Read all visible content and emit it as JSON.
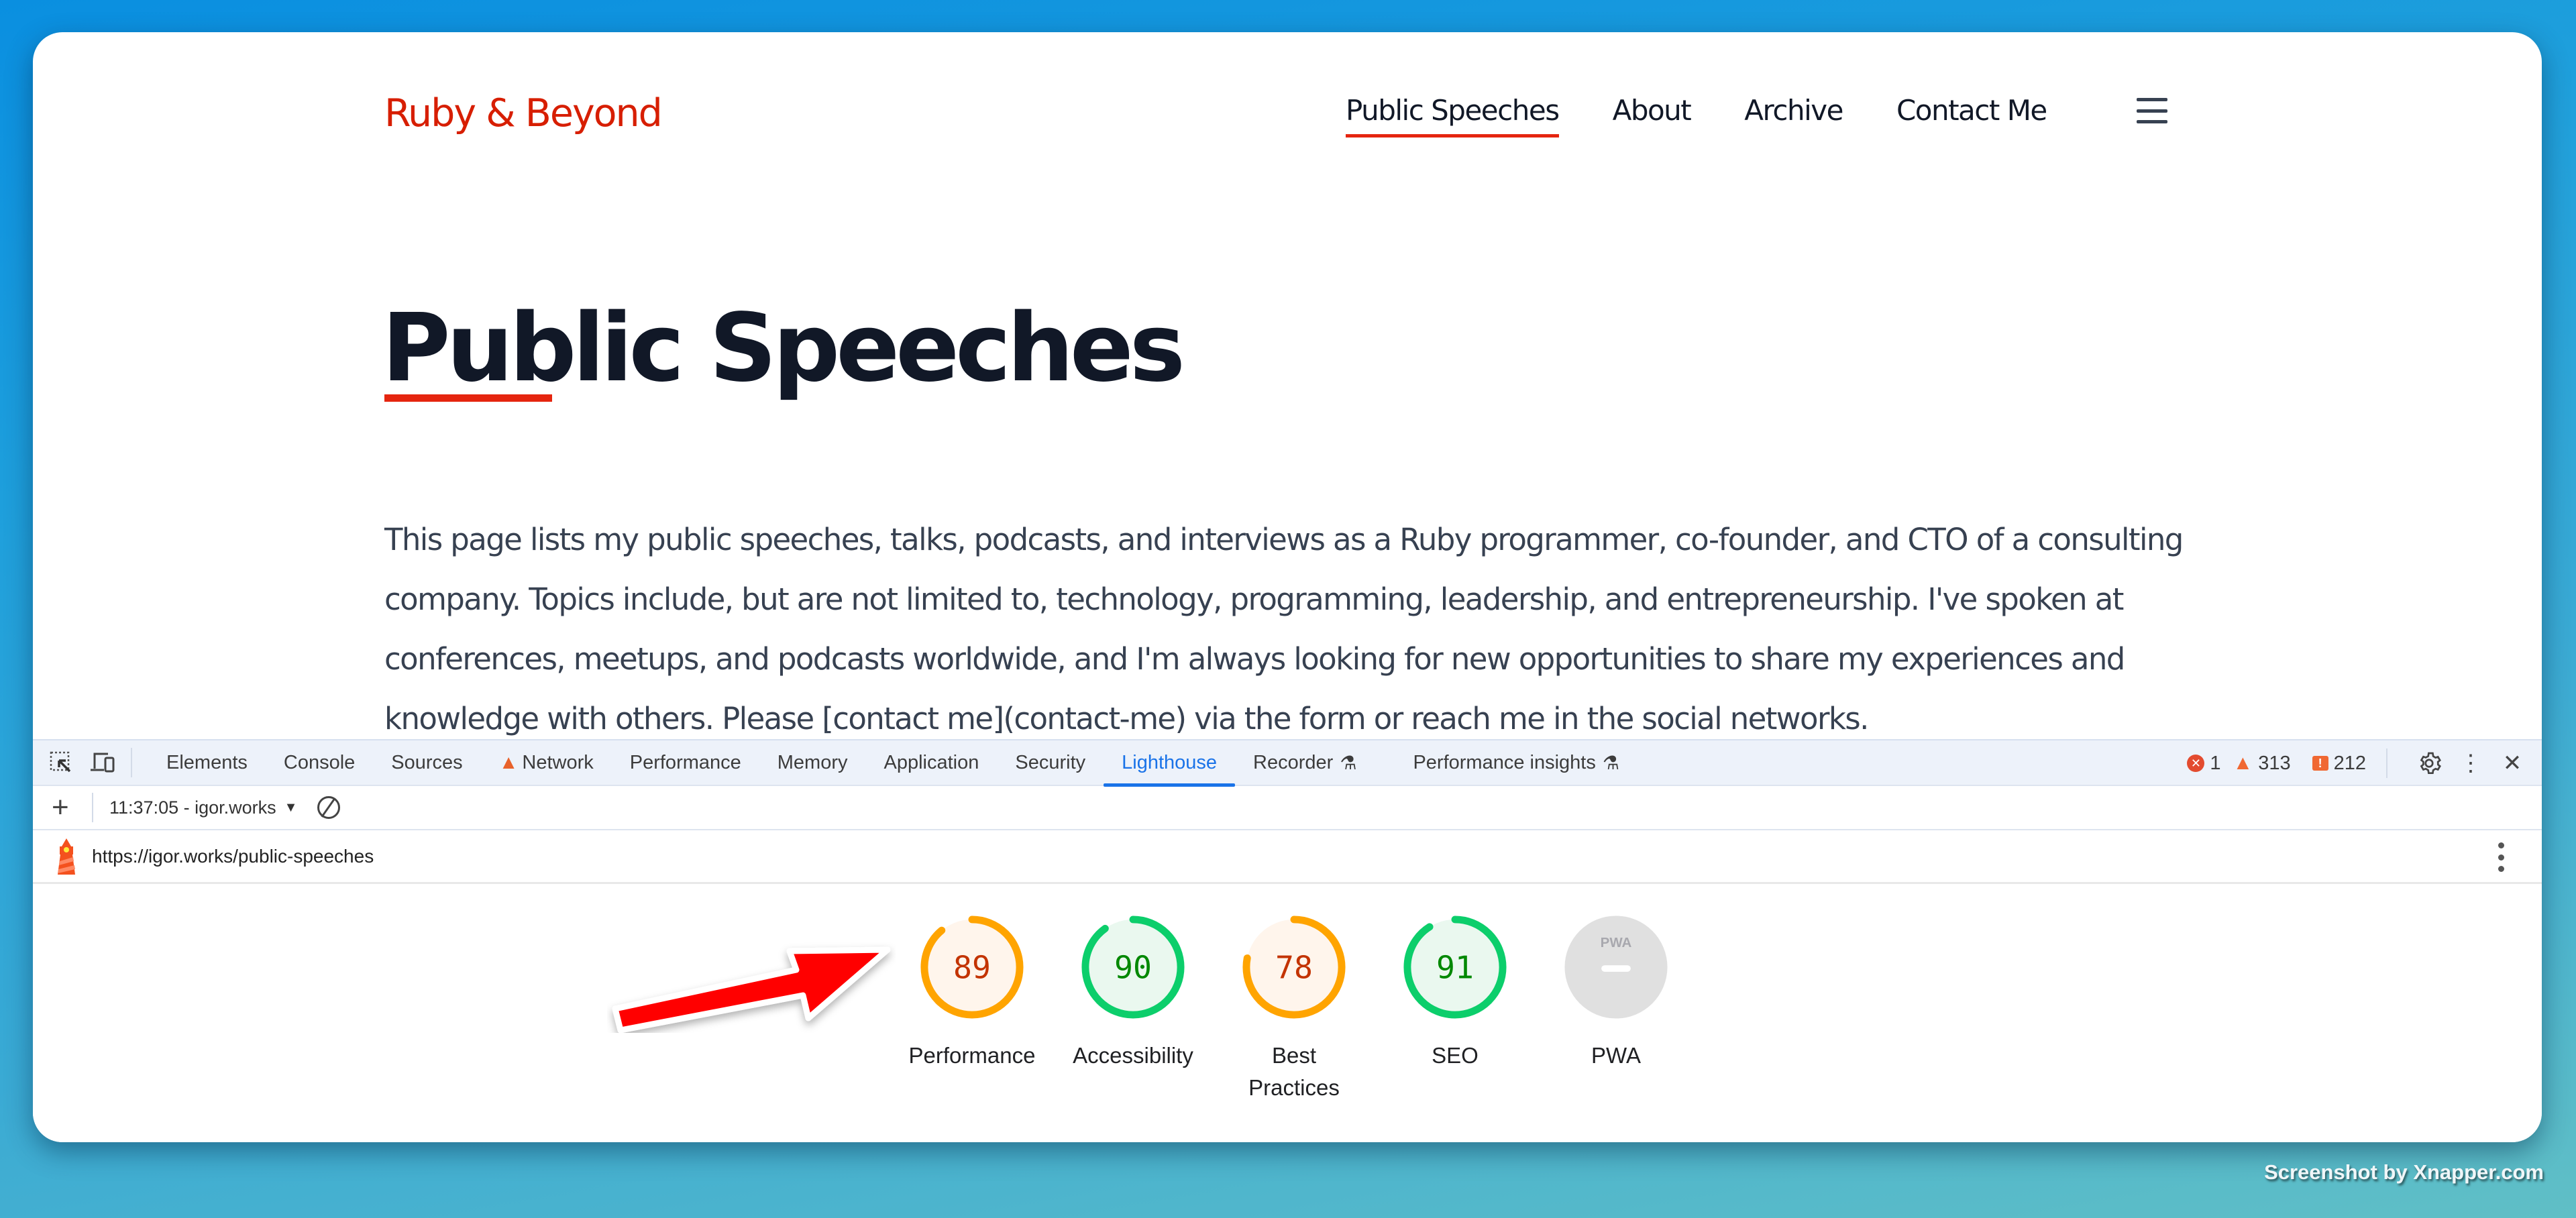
{
  "site": {
    "brand": "Ruby & Beyond",
    "nav": [
      {
        "label": "Public Speeches",
        "active": true
      },
      {
        "label": "About",
        "active": false
      },
      {
        "label": "Archive",
        "active": false
      },
      {
        "label": "Contact Me",
        "active": false
      }
    ],
    "menu_icon": "hamburger-icon",
    "title": "Public Speeches",
    "intro": "This page lists my public speeches, talks, podcasts, and interviews as a Ruby programmer, co-founder, and CTO of a consulting company. Topics include, but are not limited to, technology, programming, leadership, and entrepreneurship. I've spoken at conferences, meetups, and podcasts worldwide, and I'm always looking for new opportunities to share my experiences and knowledge with others. Please [contact me](contact-me) via the form or reach me in the social networks."
  },
  "devtools": {
    "tabs": [
      {
        "label": "Elements"
      },
      {
        "label": "Console"
      },
      {
        "label": "Sources"
      },
      {
        "label": "Network",
        "warning": true
      },
      {
        "label": "Performance"
      },
      {
        "label": "Memory"
      },
      {
        "label": "Application"
      },
      {
        "label": "Security"
      },
      {
        "label": "Lighthouse",
        "active": true
      },
      {
        "label": "Recorder",
        "experimental": true
      },
      {
        "label": "Performance insights",
        "experimental": true
      }
    ],
    "counts": {
      "errors": "1",
      "warnings": "313",
      "issues": "212"
    },
    "report_select": "11:37:05 - igor.works",
    "url": "https://igor.works/public-speeches",
    "colors": {
      "active_tab": "#1a73e8",
      "average": "#ffa400",
      "pass": "#0cce6b",
      "average_text": "#c33300",
      "pass_text": "#008800",
      "na": "#e0e0e0"
    }
  },
  "lighthouse": {
    "categories": [
      {
        "label": "Performance",
        "score": 89,
        "rating": "average"
      },
      {
        "label": "Accessibility",
        "score": 90,
        "rating": "pass"
      },
      {
        "label": "Best Practices",
        "score": 78,
        "rating": "average"
      },
      {
        "label": "SEO",
        "score": 91,
        "rating": "pass"
      },
      {
        "label": "PWA",
        "score": null,
        "rating": "na",
        "badge_text": "PWA"
      }
    ]
  },
  "annotation": {
    "arrow_color": "#ff0000",
    "points_to": "Performance"
  },
  "watermark": "Screenshot by Xnapper.com"
}
